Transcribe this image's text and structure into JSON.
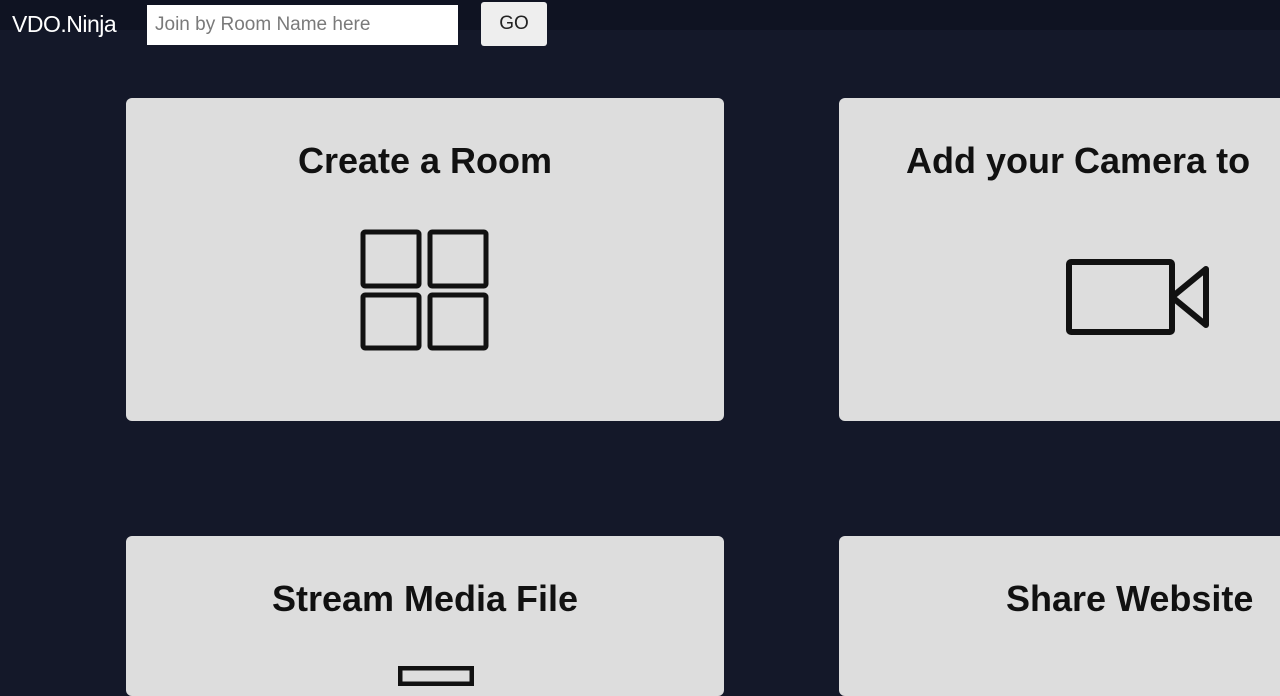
{
  "header": {
    "brand": "VDO.Ninja",
    "search_placeholder": "Join by Room Name here",
    "go_label": "GO"
  },
  "cards": [
    {
      "title": "Create a Room",
      "icon": "grid-icon"
    },
    {
      "title": "Add your Camera to",
      "icon": "video-camera-icon"
    },
    {
      "title": "Stream Media File",
      "icon": "media-file-icon"
    },
    {
      "title": "Share Website",
      "icon": "website-icon"
    }
  ],
  "colors": {
    "background": "#141829",
    "card": "#dddddd",
    "text": "#111111"
  }
}
